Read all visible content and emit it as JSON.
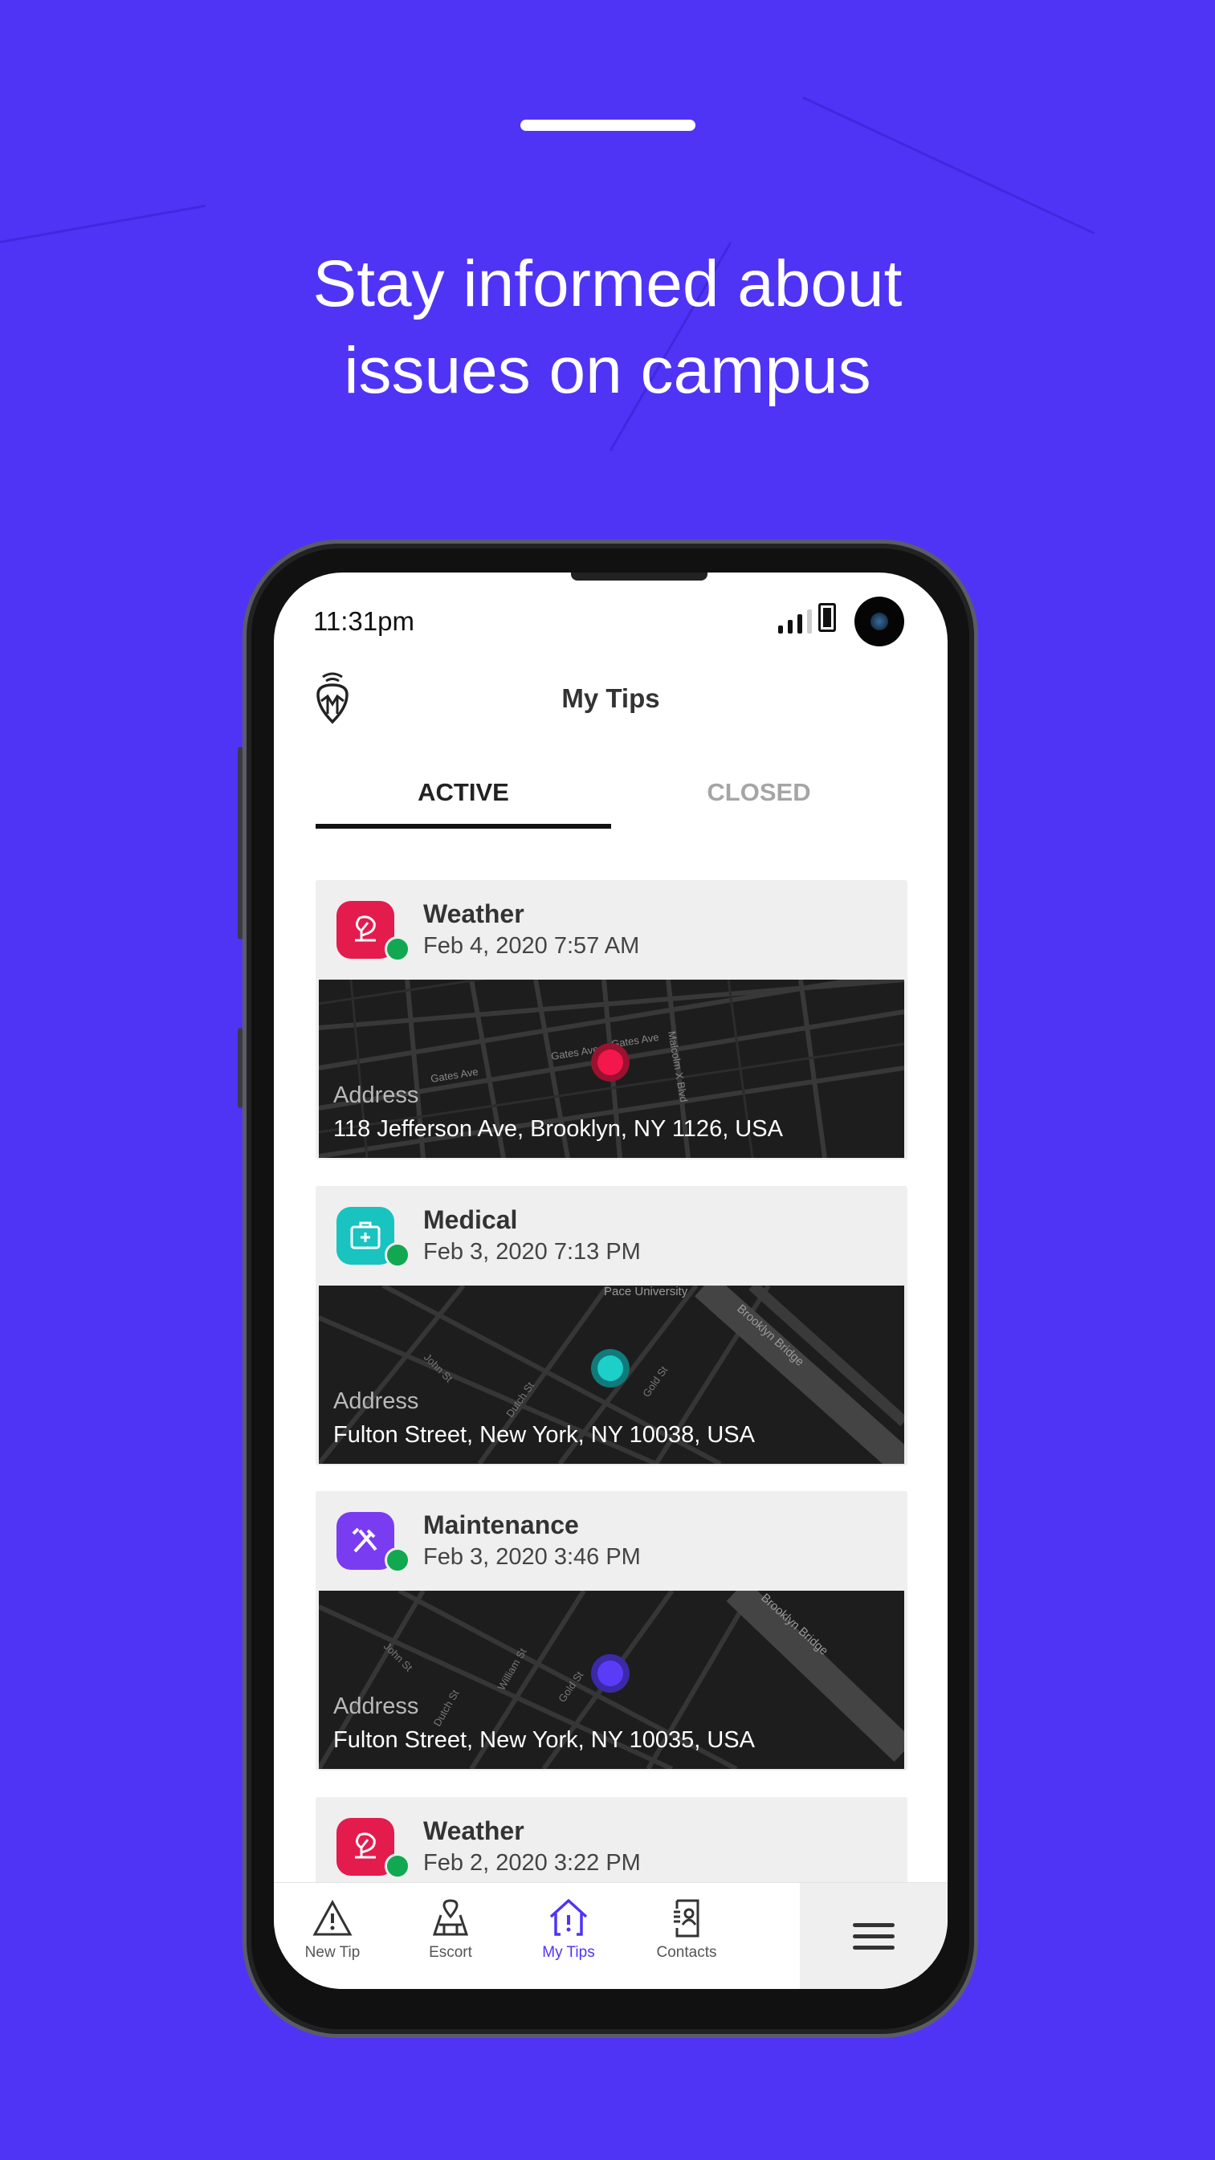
{
  "headline": {
    "line1": "Stay informed about",
    "line2": "issues on campus"
  },
  "colors": {
    "background": "#4f34f6",
    "accent": "#4f34f6",
    "active_status": "#11a851",
    "weather": "#e41b4d",
    "medical": "#18c3c0",
    "maintenance": "#7a3cf0"
  },
  "status_bar": {
    "time": "11:31pm",
    "signal_icon": "signal-icon",
    "battery_icon": "battery-icon"
  },
  "header": {
    "title": "My Tips",
    "logo_icon": "shield-pin-logo-icon"
  },
  "tabs": [
    {
      "label": "ACTIVE",
      "selected": true
    },
    {
      "label": "CLOSED",
      "selected": false
    }
  ],
  "tips": [
    {
      "category": "Weather",
      "icon": "weather-leaf-icon",
      "date": "Feb 4, 2020 7:57 AM",
      "address_label": "Address",
      "address": "118 Jefferson Ave, Brooklyn, NY 1126, USA",
      "map_labels": [
        "Gates Ave",
        "Gates Ave",
        "Gates Ave",
        "Malcolm X Blvd"
      ],
      "status": "active"
    },
    {
      "category": "Medical",
      "icon": "medical-kit-icon",
      "date": "Feb 3, 2020 7:13 PM",
      "address_label": "Address",
      "address": "Fulton Street, New York, NY 10038, USA",
      "map_labels": [
        "Pace University",
        "Brooklyn Bridge",
        "John St",
        "Dutch St",
        "Gold St"
      ],
      "status": "active"
    },
    {
      "category": "Maintenance",
      "icon": "maintenance-tools-icon",
      "date": "Feb 3, 2020 3:46 PM",
      "address_label": "Address",
      "address": "Fulton Street, New York, NY 10035, USA",
      "map_labels": [
        "Brooklyn Bridge",
        "John St",
        "Dutch St",
        "William St",
        "Gold St"
      ],
      "status": "active"
    },
    {
      "category": "Weather",
      "icon": "weather-leaf-icon",
      "date": "Feb 2, 2020 3:22 PM",
      "status": "active"
    }
  ],
  "bottom_nav": [
    {
      "label": "New Tip",
      "icon": "warning-triangle-icon",
      "selected": false
    },
    {
      "label": "Escort",
      "icon": "map-pin-icon",
      "selected": false
    },
    {
      "label": "My Tips",
      "icon": "house-alert-icon",
      "selected": true
    },
    {
      "label": "Contacts",
      "icon": "contacts-book-icon",
      "selected": false
    }
  ],
  "menu_icon": "hamburger-menu-icon"
}
